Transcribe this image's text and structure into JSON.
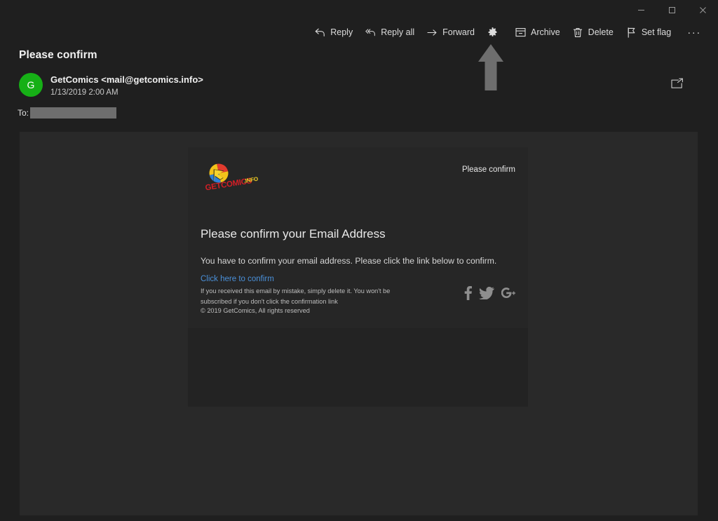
{
  "window": {
    "controls": [
      {
        "name": "minimize",
        "label": "Minimize"
      },
      {
        "name": "maximize",
        "label": "Restore"
      },
      {
        "name": "close",
        "label": "Close"
      }
    ]
  },
  "toolbar": {
    "items": [
      {
        "icon": "reply-icon",
        "label": "Reply"
      },
      {
        "icon": "reply-all-icon",
        "label": "Reply all"
      },
      {
        "icon": "forward-icon",
        "label": "Forward"
      },
      {
        "icon": "gear-icon",
        "label": ""
      },
      {
        "icon": "archive-icon",
        "label": "Archive"
      },
      {
        "icon": "delete-icon",
        "label": "Delete"
      },
      {
        "icon": "flag-icon",
        "label": "Set flag"
      }
    ],
    "more_label": "···"
  },
  "message": {
    "subject": "Please confirm",
    "avatar_initial": "G",
    "avatar_color": "#16b016",
    "sender": "GetComics <mail@getcomics.info>",
    "date": "1/13/2019 2:00 AM",
    "to_label": "To:",
    "to_value": "",
    "popout_label": "Open in new window"
  },
  "email": {
    "preheader": "Please confirm",
    "brand_name": "GETCOMICS",
    "brand_tld": ".INFO",
    "headline": "Please confirm your Email Address",
    "body": "You have to confirm your email address. Please click the link below to confirm.",
    "link_text": "Click here to confirm",
    "link_color": "#4a90d9",
    "footer_note": "If you received this email by mistake, simply delete it. You won't be subscribed if you don't click the confirmation link",
    "copyright": "© 2019 GetComics, All rights reserved",
    "social": [
      {
        "icon": "facebook-icon",
        "label": "Facebook"
      },
      {
        "icon": "twitter-icon",
        "label": "Twitter"
      },
      {
        "icon": "google-plus-icon",
        "label": "Google Plus"
      }
    ]
  },
  "annotation": {
    "arrow_label": "up-arrow pointing at settings",
    "arrow_color": "#6e6e6e"
  }
}
